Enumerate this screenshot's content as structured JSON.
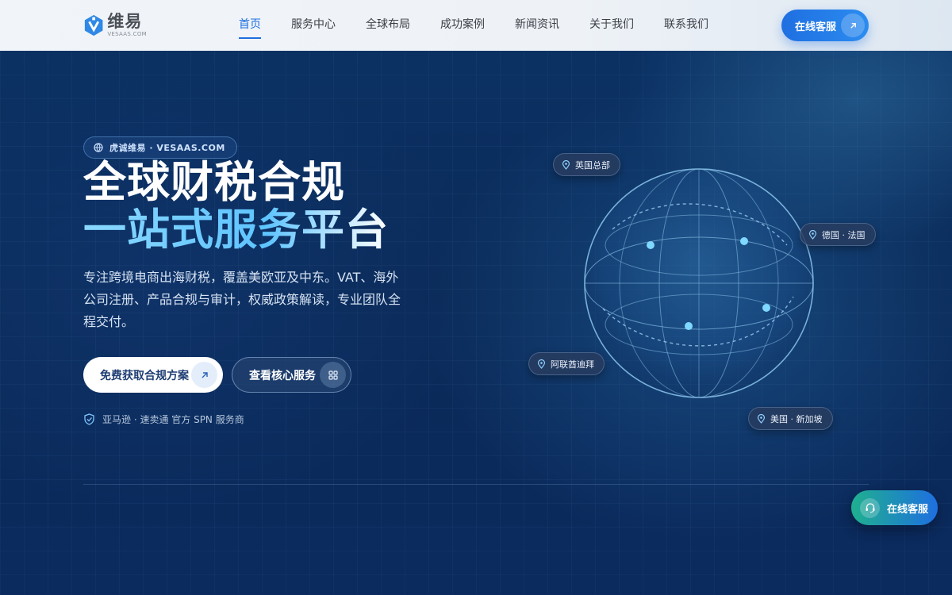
{
  "header": {
    "logo": {
      "cn": "维易",
      "en": "VESAAS.COM",
      "icon": "hexagon-v-logo"
    },
    "nav": [
      {
        "label": "首页",
        "active": true
      },
      {
        "label": "服务中心",
        "active": false
      },
      {
        "label": "全球布局",
        "active": false
      },
      {
        "label": "成功案例",
        "active": false
      },
      {
        "label": "新闻资讯",
        "active": false
      },
      {
        "label": "关于我们",
        "active": false
      },
      {
        "label": "联系我们",
        "active": false
      }
    ],
    "cta_label": "在线客服",
    "cta_icon": "arrow-up-right-icon"
  },
  "hero": {
    "tag": "虎诚维易 · VESAAS.COM",
    "tag_icon": "globe-icon",
    "title_line1": "全球财税合规",
    "title_line2": "一站式服务平台",
    "description": "专注跨境电商出海财税，覆盖美欧亚及中东。VAT、海外公司注册、产品合规与审计，权威政策解读，专业团队全程交付。",
    "primary_button": "免费获取合规方案",
    "secondary_button": "查看核心服务",
    "trust_text": "亚马逊 · 速卖通 官方 SPN 服务商",
    "trust_icon": "shield-check-icon"
  },
  "globe": {
    "locations": [
      {
        "label": "英国总部"
      },
      {
        "label": "德国 · 法国"
      },
      {
        "label": "阿联酋迪拜"
      },
      {
        "label": "美国 · 新加坡"
      }
    ]
  },
  "floating": {
    "label": "在线客服",
    "icon": "headset-icon"
  },
  "colors": {
    "accent": "#1d6fe0",
    "hero_bg": "#0b2a5e",
    "highlight": "#7fd3ff",
    "float_start": "#1fb08f"
  }
}
